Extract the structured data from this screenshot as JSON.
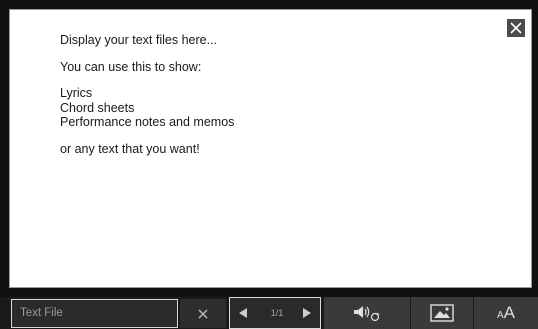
{
  "text_display": {
    "lines": {
      "l1": "Display your text files here...",
      "l2": "You can use this to show:",
      "l3": "Lyrics",
      "l4": "Chord sheets",
      "l5": "Performance notes and memos",
      "l6": "or any text that you want!"
    }
  },
  "toolbar": {
    "textfile_placeholder": "Text File",
    "page_indicator": "1/1",
    "font_label_small": "A",
    "font_label_large": "A"
  },
  "icons": {
    "close": "close-icon",
    "clear": "clear-x-icon",
    "prev": "triangle-left-icon",
    "next": "triangle-right-icon",
    "audio": "speaker-loop-icon",
    "image": "image-icon",
    "font_size": "font-size-icon"
  },
  "colors": {
    "background": "#0d0d0d",
    "panel": "#ffffff",
    "toolbar_button": "#3a3a3a",
    "highlight_border": "#d8d8d8"
  }
}
